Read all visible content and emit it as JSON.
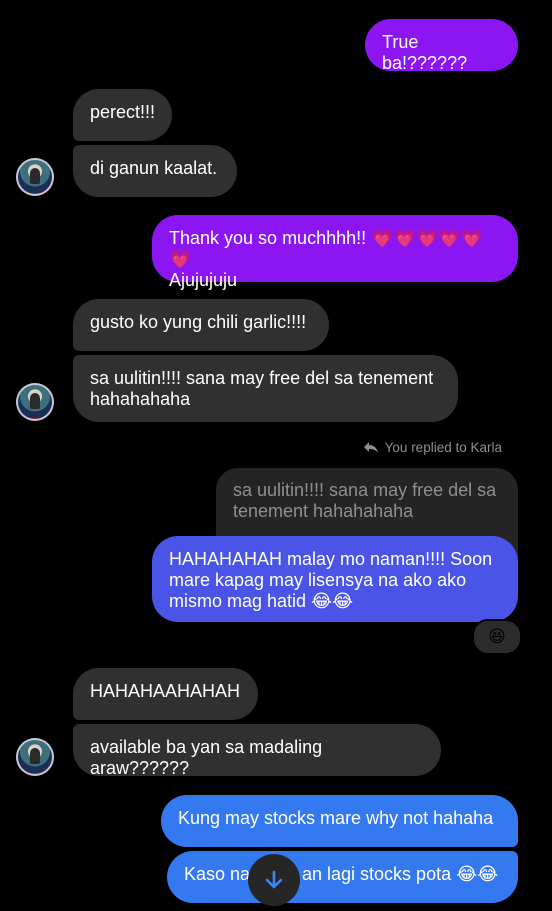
{
  "messages": {
    "m1": "True ba!??????",
    "m2": "perect!!!",
    "m3": "di ganun kaalat.",
    "m4_line1": "Thank you so muchhhh!! 💗💗💗💗💗💗",
    "m4_line2": "Ajujujuju",
    "m5": "gusto ko yung chili garlic!!!!",
    "m6": "sa uulitin!!!! sana may free del sa tenement hahahahaha",
    "m7": "HAHAHAHAH malay mo naman!!!! Soon mare kapag may lisensya na ako ako mismo mag hatid 😂😂",
    "m8": "HAHAHAAHAHAH",
    "m9": "available ba yan sa madaling araw??????",
    "m10": "Kung may stocks mare why not hahaha",
    "m11_left": "Kaso na",
    "m11_right": "an lagi stocks pota 😂😂"
  },
  "reply": {
    "meta": "You replied to Karla",
    "quoted": "sa uulitin!!!! sana may free del sa tenement hahahahaha"
  },
  "reaction": "😆",
  "icons": {
    "reply": "reply-arrow-icon",
    "scroll": "arrow-down-icon",
    "avatar": "contact-avatar"
  },
  "colors": {
    "incoming": "#303030",
    "outgoing_purple": "#8c16f2",
    "outgoing_blue": "#3579f0",
    "background": "#000000"
  }
}
